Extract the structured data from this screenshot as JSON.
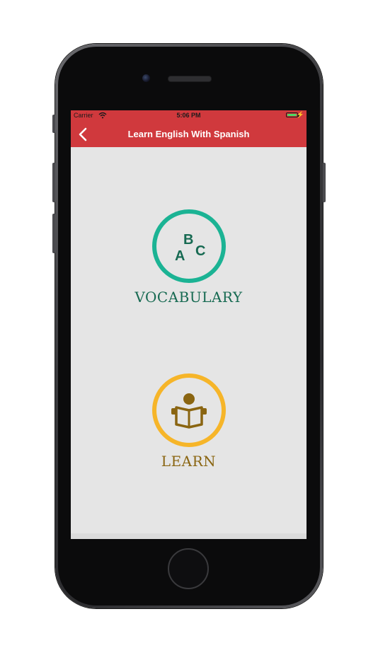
{
  "status_bar": {
    "carrier": "Carrier",
    "time": "5:06 PM"
  },
  "nav": {
    "title": "Learn English With Spanish",
    "back_icon": "chevron-left-icon"
  },
  "menu": {
    "vocabulary": {
      "label": "VOCABULARY",
      "icon_letters": [
        "A",
        "B",
        "C"
      ],
      "color": "#1bb394",
      "text_color": "#176a52"
    },
    "learn": {
      "label": "LEARN",
      "icon": "reading-book-icon",
      "color": "#f6b529",
      "text_color": "#8a6511"
    }
  },
  "colors": {
    "nav_background": "#d0393d",
    "screen_background": "#e5e5e5"
  }
}
